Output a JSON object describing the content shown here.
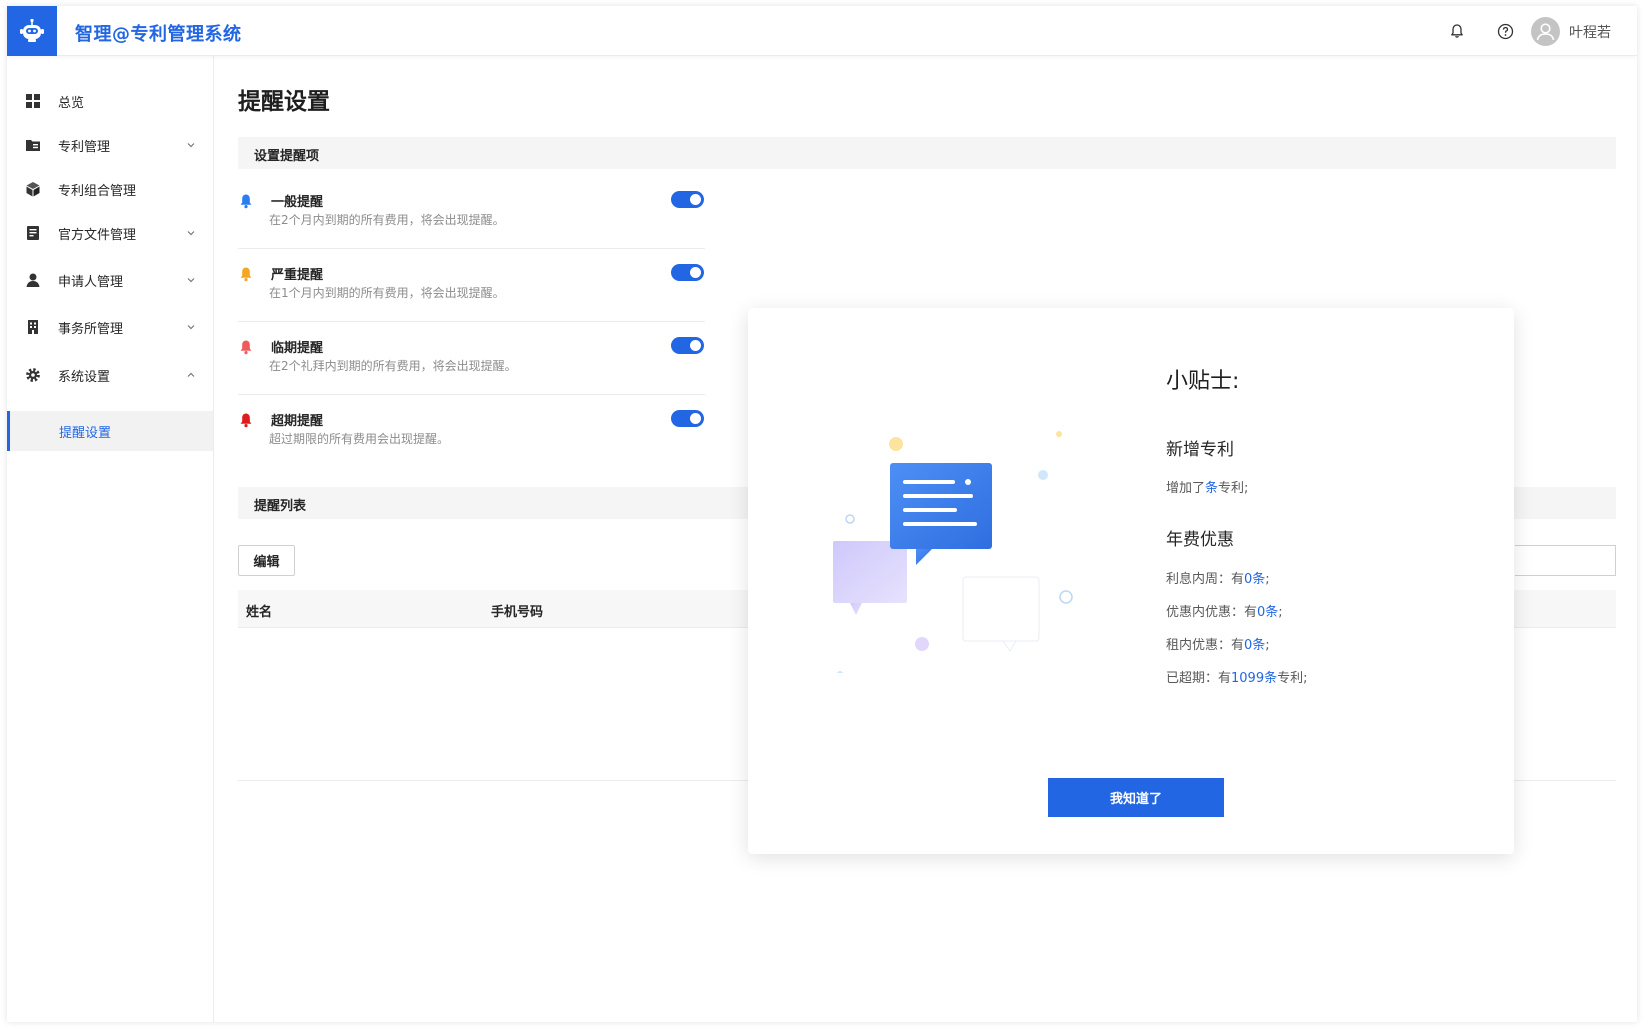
{
  "header": {
    "app_title": "智理@专利管理系统",
    "user_name": "叶程若",
    "icons": [
      "robot-logo-icon",
      "bell-icon",
      "help-icon",
      "user-avatar-icon"
    ]
  },
  "sidebar": {
    "items": [
      {
        "label": "总览",
        "icon": "dashboard-icon",
        "has_children": false
      },
      {
        "label": "专利管理",
        "icon": "folder-icon",
        "has_children": true
      },
      {
        "label": "专利组合管理",
        "icon": "cube-icon",
        "has_children": false
      },
      {
        "label": "官方文件管理",
        "icon": "document-icon",
        "has_children": true
      },
      {
        "label": "申请人管理",
        "icon": "person-icon",
        "has_children": true
      },
      {
        "label": "事务所管理",
        "icon": "building-icon",
        "has_children": true
      },
      {
        "label": "系统设置",
        "icon": "gear-icon",
        "has_children": true,
        "expanded": true
      }
    ],
    "active_sub": "提醒设置"
  },
  "main": {
    "page_title": "提醒设置",
    "settings_section": "设置提醒项",
    "reminders": [
      {
        "title": "一般提醒",
        "desc": "在2个月内到期的所有费用，将会出现提醒。",
        "bell_color": "#2a7ef2",
        "enabled": true
      },
      {
        "title": "严重提醒",
        "desc": "在1个月内到期的所有费用，将会出现提醒。",
        "bell_color": "#f5a623",
        "enabled": true
      },
      {
        "title": "临期提醒",
        "desc": "在2个礼拜内到期的所有费用，将会出现提醒。",
        "bell_color": "#f05a5a",
        "enabled": true
      },
      {
        "title": "超期提醒",
        "desc": "超过期限的所有费用会出现提醒。",
        "bell_color": "#e01b1b",
        "enabled": true
      }
    ],
    "list_section": "提醒列表",
    "edit_label": "编辑",
    "columns": [
      "姓名",
      "手机号码"
    ]
  },
  "modal": {
    "title": "小贴士:",
    "new_patent_heading": "新增专利",
    "new_patent_pre": "增加了",
    "new_patent_count": "条",
    "new_patent_post": "专利;",
    "fee_heading": "年费优惠",
    "lines": [
      {
        "label": "利息内周：有",
        "value": "0条",
        "suffix": ";"
      },
      {
        "label": "优惠内优惠：有",
        "value": "0条",
        "suffix": ";"
      },
      {
        "label": "租内优惠：有",
        "value": "0条",
        "suffix": ";"
      },
      {
        "label": "已超期：有",
        "value": "1099条",
        "suffix": "专利;"
      }
    ],
    "ok_label": "我知道了"
  },
  "colors": {
    "primary": "#2266e3"
  }
}
